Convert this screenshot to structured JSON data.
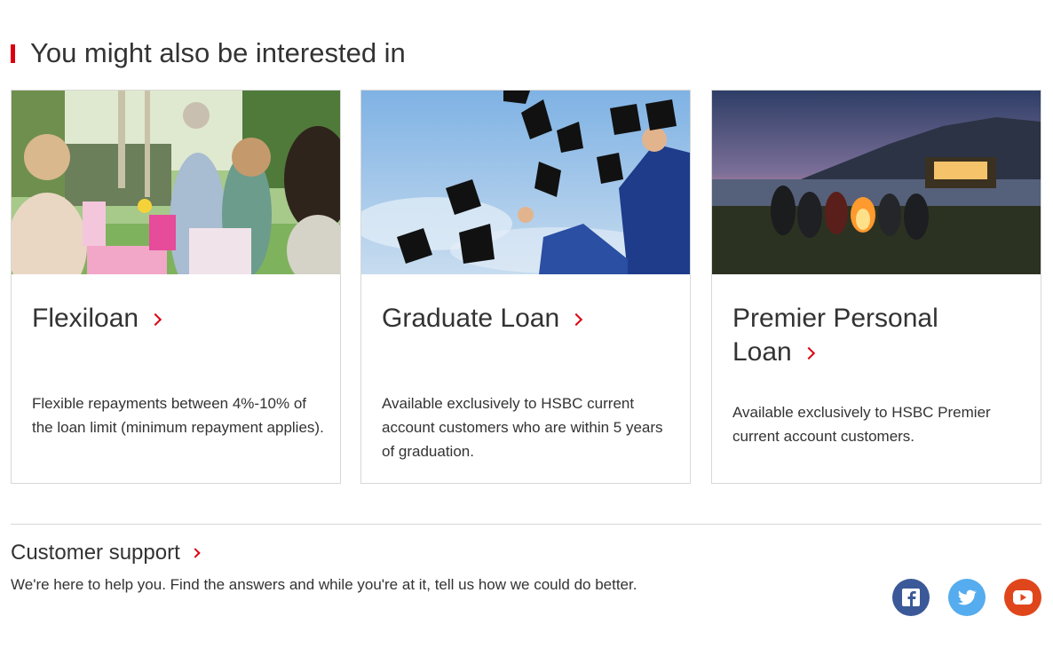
{
  "section": {
    "title": "You might also be interested in"
  },
  "cards": [
    {
      "title": "Flexiloan",
      "description": "Flexible repayments between 4%-10% of the loan limit (minimum repayment applies)."
    },
    {
      "title": "Graduate Loan",
      "description": "Available exclusively to HSBC current account customers who are within 5 years of graduation."
    },
    {
      "title_line1": "Premier Personal",
      "title_line2": "Loan",
      "description": "Available exclusively to HSBC Premier current account customers."
    }
  ],
  "support": {
    "title": "Customer support",
    "text": "We're here to help you. Find the answers and while you're at it, tell us how we could do better."
  },
  "social": {
    "facebook": {
      "icon": "facebook-icon",
      "color": "#3b5998"
    },
    "twitter": {
      "icon": "twitter-icon",
      "color": "#55acee"
    },
    "youtube": {
      "icon": "youtube-icon",
      "color": "#e0461c"
    }
  },
  "colors": {
    "accent": "#db0011",
    "text": "#333333",
    "border": "#d7d8d6"
  }
}
